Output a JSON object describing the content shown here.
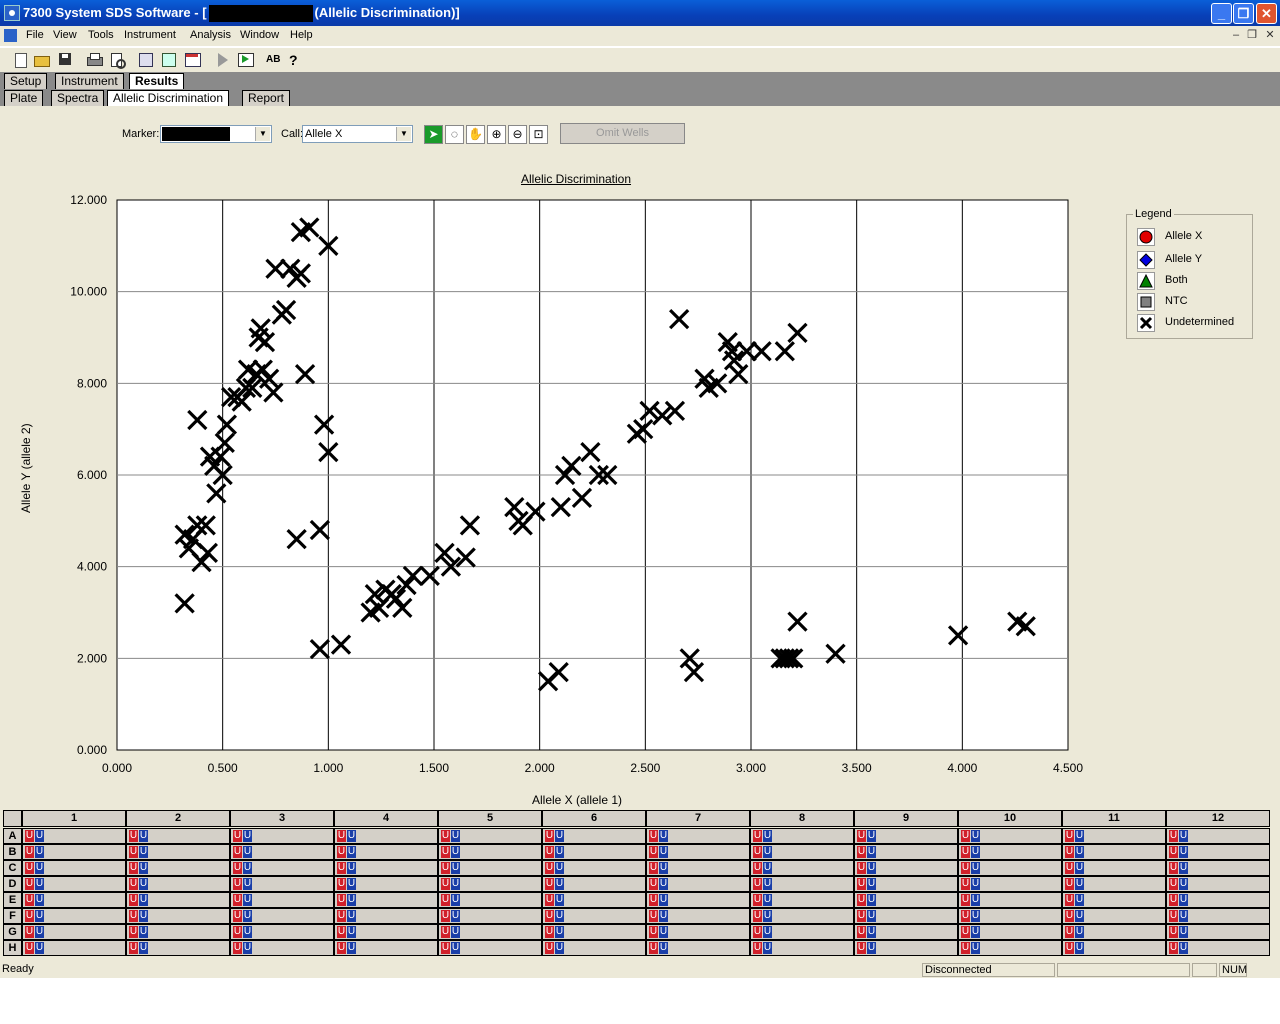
{
  "window": {
    "title_prefix": "7300 System SDS Software - [",
    "title_suffix": "(Allelic Discrimination)]"
  },
  "menu": [
    "File",
    "View",
    "Tools",
    "Instrument",
    "Analysis",
    "Window",
    "Help"
  ],
  "tabs_main": [
    {
      "label": "Setup",
      "active": false
    },
    {
      "label": "Instrument",
      "active": false
    },
    {
      "label": "Results",
      "active": true
    }
  ],
  "tabs_sub": [
    {
      "label": "Plate",
      "active": false
    },
    {
      "label": "Spectra",
      "active": false
    },
    {
      "label": "Allelic Discrimination",
      "active": true
    },
    {
      "label": "Report",
      "active": false
    }
  ],
  "controls": {
    "marker_label": "Marker:",
    "call_label": "Call:",
    "call_value": "Allele X",
    "omit_label": "Omit Wells"
  },
  "chart_data": {
    "type": "scatter",
    "title": "Allelic Discrimination",
    "xlabel": "Allele X (allele 1)",
    "ylabel": "Allele Y (allele 2)",
    "xlim": [
      0,
      4.5
    ],
    "ylim": [
      0,
      12
    ],
    "xticks": [
      "0.000",
      "0.500",
      "1.000",
      "1.500",
      "2.000",
      "2.500",
      "3.000",
      "3.500",
      "4.000",
      "4.500"
    ],
    "yticks": [
      "0.000",
      "2.000",
      "4.000",
      "6.000",
      "8.000",
      "10.000",
      "12.000"
    ],
    "grid": true,
    "series": [
      {
        "name": "Undetermined",
        "marker": "x",
        "color": "#000000",
        "points": [
          [
            0.32,
            3.2
          ],
          [
            0.32,
            4.7
          ],
          [
            0.34,
            4.4
          ],
          [
            0.36,
            4.6
          ],
          [
            0.38,
            4.9
          ],
          [
            0.4,
            4.1
          ],
          [
            0.42,
            4.9
          ],
          [
            0.43,
            4.3
          ],
          [
            0.38,
            7.2
          ],
          [
            0.44,
            6.4
          ],
          [
            0.46,
            6.2
          ],
          [
            0.47,
            5.6
          ],
          [
            0.49,
            6.4
          ],
          [
            0.5,
            6.0
          ],
          [
            0.51,
            6.7
          ],
          [
            0.52,
            7.1
          ],
          [
            0.54,
            7.7
          ],
          [
            0.57,
            7.7
          ],
          [
            0.59,
            7.6
          ],
          [
            0.61,
            7.9
          ],
          [
            0.62,
            8.3
          ],
          [
            0.64,
            7.9
          ],
          [
            0.66,
            8.2
          ],
          [
            0.67,
            9.0
          ],
          [
            0.68,
            9.2
          ],
          [
            0.7,
            8.9
          ],
          [
            0.69,
            8.3
          ],
          [
            0.72,
            8.1
          ],
          [
            0.74,
            7.8
          ],
          [
            0.75,
            10.5
          ],
          [
            0.78,
            9.5
          ],
          [
            0.8,
            9.6
          ],
          [
            0.82,
            10.5
          ],
          [
            0.85,
            10.3
          ],
          [
            0.87,
            10.4
          ],
          [
            0.87,
            11.3
          ],
          [
            0.91,
            11.4
          ],
          [
            0.89,
            8.2
          ],
          [
            0.85,
            4.6
          ],
          [
            0.96,
            4.8
          ],
          [
            0.98,
            7.1
          ],
          [
            1.0,
            6.5
          ],
          [
            1.0,
            11.0
          ],
          [
            0.96,
            2.2
          ],
          [
            1.06,
            2.3
          ],
          [
            1.2,
            3.0
          ],
          [
            1.22,
            3.4
          ],
          [
            1.24,
            3.1
          ],
          [
            1.27,
            3.5
          ],
          [
            1.3,
            3.4
          ],
          [
            1.32,
            3.3
          ],
          [
            1.35,
            3.1
          ],
          [
            1.37,
            3.6
          ],
          [
            1.4,
            3.8
          ],
          [
            1.48,
            3.8
          ],
          [
            1.55,
            4.3
          ],
          [
            1.58,
            4.0
          ],
          [
            1.65,
            4.2
          ],
          [
            1.67,
            4.9
          ],
          [
            1.88,
            5.3
          ],
          [
            1.9,
            5.0
          ],
          [
            1.92,
            4.9
          ],
          [
            1.98,
            5.2
          ],
          [
            2.04,
            1.5
          ],
          [
            2.09,
            1.7
          ],
          [
            2.1,
            5.3
          ],
          [
            2.12,
            6.0
          ],
          [
            2.15,
            6.2
          ],
          [
            2.2,
            5.5
          ],
          [
            2.24,
            6.5
          ],
          [
            2.28,
            6.0
          ],
          [
            2.32,
            6.0
          ],
          [
            2.46,
            6.9
          ],
          [
            2.49,
            7.0
          ],
          [
            2.52,
            7.4
          ],
          [
            2.58,
            7.3
          ],
          [
            2.64,
            7.4
          ],
          [
            2.66,
            9.4
          ],
          [
            2.71,
            2.0
          ],
          [
            2.73,
            1.7
          ],
          [
            2.78,
            8.1
          ],
          [
            2.8,
            7.9
          ],
          [
            2.84,
            8.0
          ],
          [
            2.89,
            8.9
          ],
          [
            2.91,
            8.7
          ],
          [
            2.92,
            8.5
          ],
          [
            2.94,
            8.2
          ],
          [
            2.98,
            8.7
          ],
          [
            3.05,
            8.7
          ],
          [
            3.14,
            2.0
          ],
          [
            3.16,
            2.0
          ],
          [
            3.18,
            2.0
          ],
          [
            3.2,
            2.0
          ],
          [
            3.16,
            8.7
          ],
          [
            3.22,
            9.1
          ],
          [
            3.22,
            2.8
          ],
          [
            3.4,
            2.1
          ],
          [
            3.98,
            2.5
          ],
          [
            4.26,
            2.8
          ],
          [
            4.3,
            2.7
          ]
        ]
      }
    ]
  },
  "legend": {
    "title": "Legend",
    "items": [
      {
        "label": "Allele X",
        "shape": "circle",
        "color": "#e00000"
      },
      {
        "label": "Allele Y",
        "shape": "diamond",
        "color": "#0000e0"
      },
      {
        "label": "Both",
        "shape": "triangle",
        "color": "#008000"
      },
      {
        "label": "NTC",
        "shape": "square",
        "color": "#808080"
      },
      {
        "label": "Undetermined",
        "shape": "x",
        "color": "#000000"
      }
    ]
  },
  "plate": {
    "columns": [
      "1",
      "2",
      "3",
      "4",
      "5",
      "6",
      "7",
      "8",
      "9",
      "10",
      "11",
      "12"
    ],
    "rows": [
      "A",
      "B",
      "C",
      "D",
      "E",
      "F",
      "G",
      "H"
    ],
    "well_labels": [
      "U",
      "U"
    ]
  },
  "status": {
    "left": "Ready",
    "conn": "Disconnected",
    "num": "NUM"
  }
}
